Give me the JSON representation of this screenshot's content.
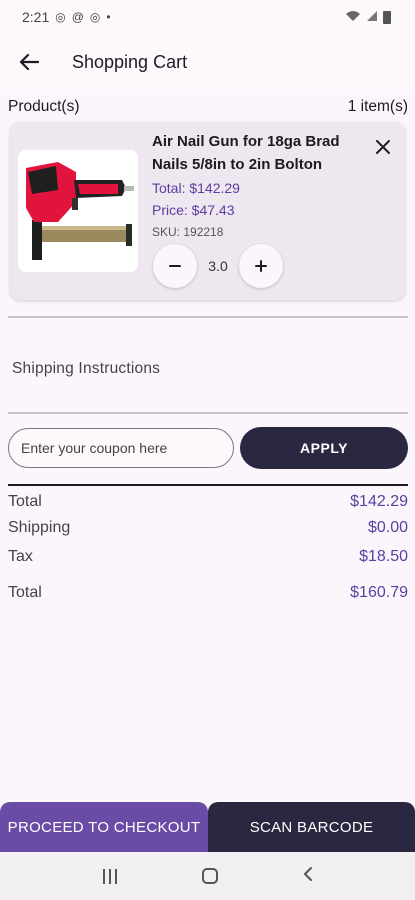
{
  "status_bar": {
    "time": "2:21",
    "dot": "•"
  },
  "app_bar": {
    "title": "Shopping Cart"
  },
  "products_header": {
    "label": "Product(s)",
    "count": "1 item(s)"
  },
  "cart_items": [
    {
      "name": "Air Nail Gun for 18ga Brad Nails  5/8in to 2in Bolton",
      "total": "Total: $142.29",
      "price": "Price: $47.43",
      "sku": "SKU: 192218",
      "quantity": "3.0"
    }
  ],
  "shipping": {
    "label": "Shipping Instructions"
  },
  "coupon": {
    "placeholder": "Enter your coupon here",
    "value": "",
    "apply_label": "APPLY"
  },
  "summary": {
    "total_label": "Total",
    "total_value": "$142.29",
    "shipping_label": "Shipping",
    "shipping_value": "$0.00",
    "tax_label": "Tax",
    "tax_value": "$18.50",
    "grand_total_label": "Total",
    "grand_total_value": "$160.79"
  },
  "actions": {
    "checkout_label": "PROCEED TO CHECKOUT",
    "scan_label": "SCAN BARCODE"
  },
  "colors": {
    "accent": "#5a3fa0",
    "checkout_bg": "#6a4ba6",
    "dark_button": "#2a2840",
    "background": "#fbf6fb",
    "card": "#efe7f0"
  },
  "icons": {
    "back": "arrow-left-icon",
    "remove": "close-icon",
    "minus": "minus-icon",
    "plus": "plus-icon"
  }
}
